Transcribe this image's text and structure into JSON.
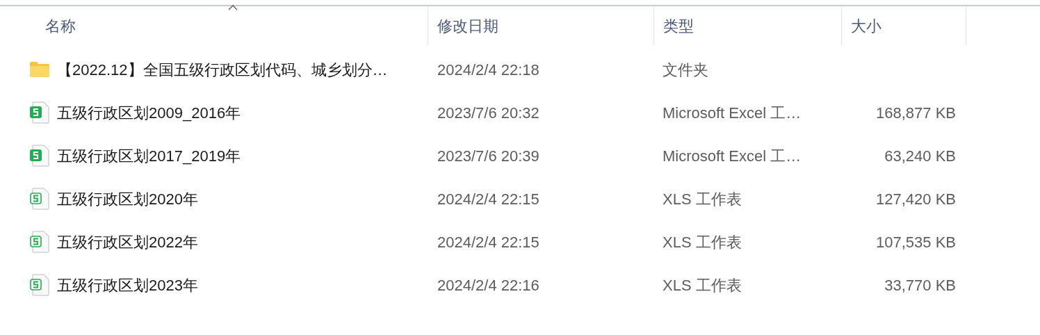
{
  "columns": [
    {
      "label": "名称",
      "sorted": true
    },
    {
      "label": "修改日期",
      "sorted": false
    },
    {
      "label": "类型",
      "sorted": false
    },
    {
      "label": "大小",
      "sorted": false
    }
  ],
  "rows": [
    {
      "kind": "folder",
      "name": "【2022.12】全国五级行政区划代码、城乡划分…",
      "modified": "2024/2/4 22:18",
      "type": "文件夹"
    },
    {
      "kind": "excel",
      "name": "五级行政区划2009_2016年",
      "modified": "2023/7/6 20:32",
      "type": "Microsoft Excel 工…",
      "size": "168,877 KB"
    },
    {
      "kind": "excel",
      "name": "五级行政区划2017_2019年",
      "modified": "2023/7/6 20:39",
      "type": "Microsoft Excel 工…",
      "size": "63,240 KB"
    },
    {
      "kind": "xls",
      "name": "五级行政区划2020年",
      "modified": "2024/2/4 22:15",
      "type": "XLS 工作表",
      "size": "127,420 KB"
    },
    {
      "kind": "xls",
      "name": "五级行政区划2022年",
      "modified": "2024/2/4 22:15",
      "type": "XLS 工作表",
      "size": "107,535 KB"
    },
    {
      "kind": "xls",
      "name": "五级行政区划2023年",
      "modified": "2024/2/4 22:16",
      "type": "XLS 工作表",
      "size": "33,770 KB"
    }
  ]
}
